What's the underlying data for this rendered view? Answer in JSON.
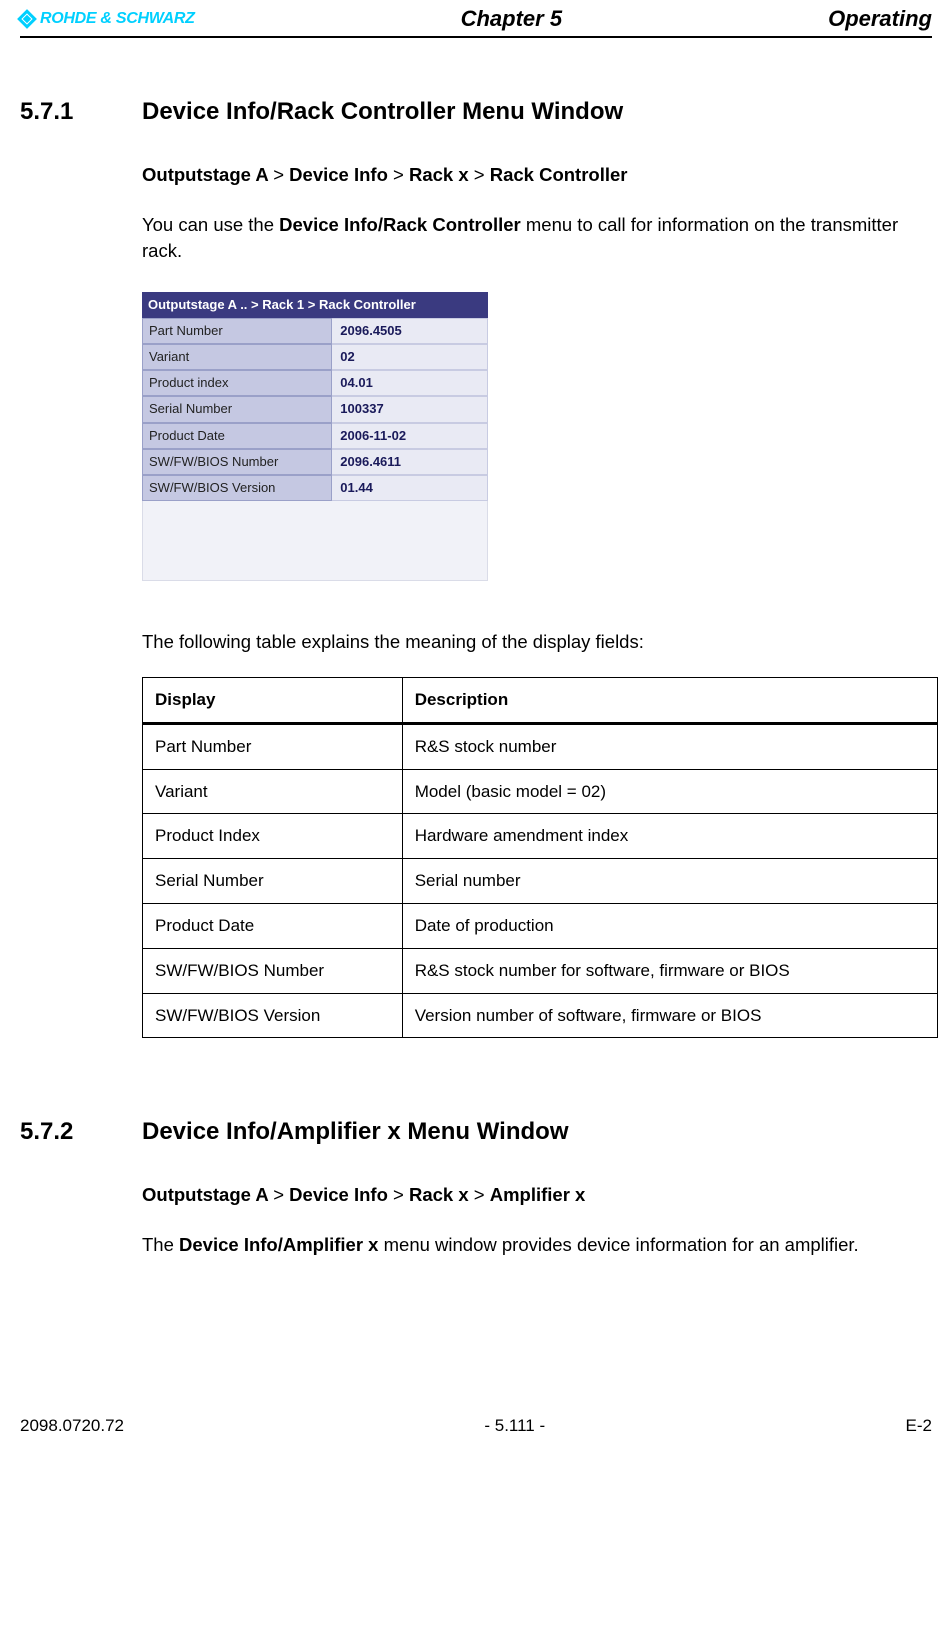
{
  "header": {
    "logo_text": "ROHDE & SCHWARZ",
    "chapter": "Chapter 5",
    "operating": "Operating"
  },
  "section1": {
    "number": "5.7.1",
    "title": "Device Info/Rack Controller Menu Window",
    "breadcrumb": {
      "p1": "Outputstage A",
      "p2": "Device Info",
      "p3": "Rack x",
      "p4": "Rack Controller"
    },
    "para_pre": "You can use the ",
    "para_bold": "Device Info/Rack Controller",
    "para_post": " menu to call for information on the transmitter rack.",
    "ui_title": "Outputstage A .. > Rack 1 > Rack Controller",
    "ui_rows": [
      {
        "label": "Part Number",
        "value": "2096.4505"
      },
      {
        "label": "Variant",
        "value": "02"
      },
      {
        "label": "Product index",
        "value": "04.01"
      },
      {
        "label": "Serial Number",
        "value": "100337"
      },
      {
        "label": "Product Date",
        "value": "2006-11-02"
      },
      {
        "label": "SW/FW/BIOS Number",
        "value": "2096.4611"
      },
      {
        "label": "SW/FW/BIOS Version",
        "value": "01.44"
      }
    ],
    "explain": "The following table explains the meaning of the display fields:",
    "table_headers": {
      "c1": "Display",
      "c2": "Description"
    },
    "table_rows": [
      {
        "display": "Part Number",
        "desc": "R&S stock number"
      },
      {
        "display": "Variant",
        "desc": "Model (basic model = 02)"
      },
      {
        "display": "Product Index",
        "desc": "Hardware amendment index"
      },
      {
        "display": "Serial Number",
        "desc": "Serial number"
      },
      {
        "display": "Product Date",
        "desc": "Date of production"
      },
      {
        "display": "SW/FW/BIOS Number",
        "desc": "R&S stock number for software, firmware or BIOS"
      },
      {
        "display": "SW/FW/BIOS Version",
        "desc": "Version number of software, firmware or BIOS"
      }
    ]
  },
  "section2": {
    "number": "5.7.2",
    "title": "Device Info/Amplifier x Menu Window",
    "breadcrumb": {
      "p1": "Outputstage A",
      "p2": "Device Info",
      "p3": "Rack x",
      "p4": "Amplifier x"
    },
    "para_pre": "The ",
    "para_bold": "Device Info/Amplifier x",
    "para_post": " menu window provides device information for an amplifier."
  },
  "footer": {
    "left": "2098.0720.72",
    "center": "- 5.111 -",
    "right": "E-2"
  }
}
